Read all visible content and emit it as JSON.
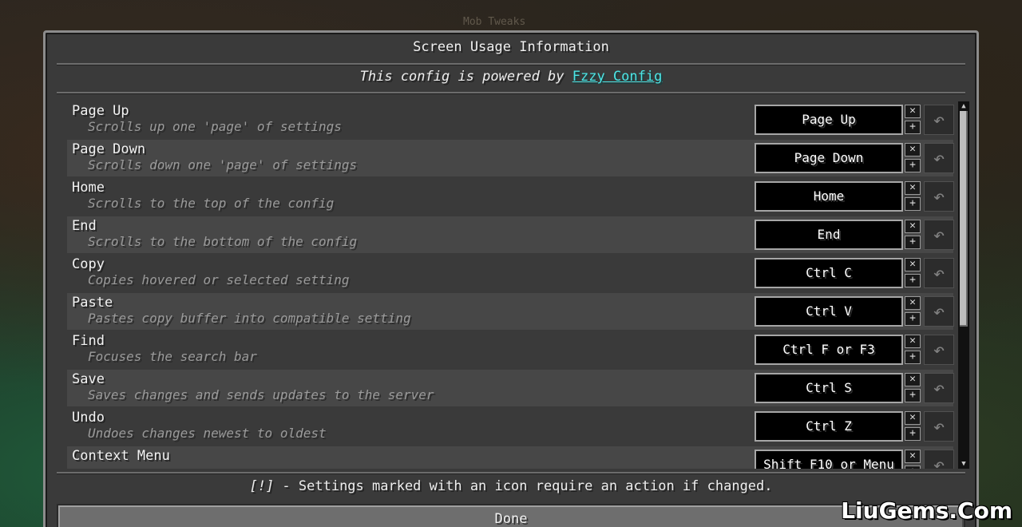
{
  "background_label": "Mob Tweaks",
  "title": "Screen Usage Information",
  "powered": {
    "prefix": "This config is powered by ",
    "link": "Fzzy Config"
  },
  "rows": [
    {
      "name": "Page Up",
      "desc": "Scrolls up one 'page' of settings",
      "key": "Page Up"
    },
    {
      "name": "Page Down",
      "desc": "Scrolls down one 'page' of settings",
      "key": "Page Down"
    },
    {
      "name": "Home",
      "desc": "Scrolls to the top of the config",
      "key": "Home"
    },
    {
      "name": "End",
      "desc": "Scrolls to the bottom of the config",
      "key": "End"
    },
    {
      "name": "Copy",
      "desc": "Copies hovered or selected setting",
      "key": "Ctrl C"
    },
    {
      "name": "Paste",
      "desc": "Pastes copy buffer into compatible setting",
      "key": "Ctrl V"
    },
    {
      "name": "Find",
      "desc": "Focuses the search bar",
      "key": "Ctrl F or F3"
    },
    {
      "name": "Save",
      "desc": "Saves changes and sends updates to the server",
      "key": "Ctrl S"
    },
    {
      "name": "Undo",
      "desc": "Undoes changes newest to oldest",
      "key": "Ctrl Z"
    },
    {
      "name": "Context Menu",
      "desc": "",
      "key": "Shift F10 or Menu"
    }
  ],
  "controls": {
    "remove_glyph": "✕",
    "add_glyph": "+",
    "reset_glyph": "↶"
  },
  "scroll": {
    "up_glyph": "▲",
    "down_glyph": "▼"
  },
  "footer": {
    "mark": "[!]",
    "text": " - Settings marked with an icon require an action if changed."
  },
  "done_label": "Done",
  "watermark": "LiuGems.Com",
  "colors": {
    "link": "#4be6e6",
    "panel": "#3a3a3a",
    "row_alt": "#474747"
  },
  "icons": {
    "reset": "undo-arrow-icon",
    "remove": "close-icon",
    "add": "plus-icon"
  }
}
